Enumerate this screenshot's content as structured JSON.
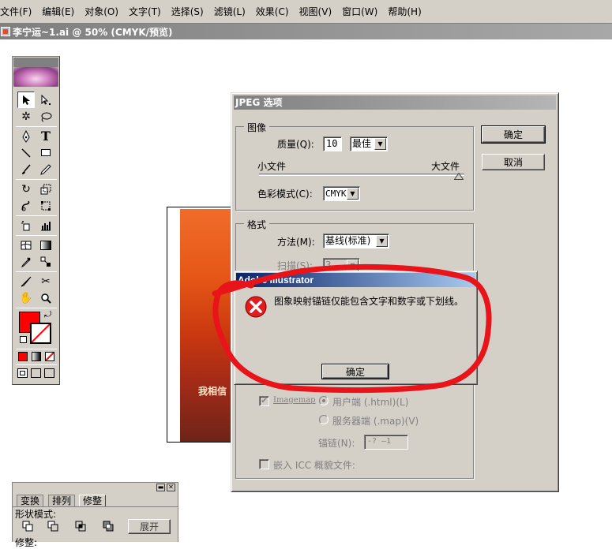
{
  "menu": [
    "文件(F)",
    "编辑(E)",
    "对象(O)",
    "文字(T)",
    "选择(S)",
    "滤镜(L)",
    "效果(C)",
    "视图(V)",
    "窗口(W)",
    "帮助(H)"
  ],
  "document": {
    "title": "李宁运~1.ai @ 50% (CMYK/预览)"
  },
  "artwork": {
    "text": "我相信"
  },
  "jpeg_dialog": {
    "title": "JPEG 选项",
    "image_group": "图像",
    "quality_label": "质量(Q):",
    "quality_value": "10",
    "quality_preset": "最佳",
    "small_file": "小文件",
    "large_file": "大文件",
    "color_mode_label": "色彩模式(C):",
    "color_mode_value": "CMYK",
    "format_group": "格式",
    "method_label": "方法(M):",
    "method_value": "基线(标准)",
    "scan_label": "扫描(S):",
    "scan_value": "3",
    "imagemap_label": "Imagemap",
    "client_side": "用户端 (.html)(L)",
    "server_side": "服务器端 (.map)(V)",
    "anchor_label": "锚链(N):",
    "anchor_value": "-?  —1",
    "embed_icc": "嵌入 ICC 概貌文件:",
    "ok_button": "确定",
    "cancel_button": "取消"
  },
  "alert": {
    "title": "Adobe Illustrator",
    "message": "图象映射锚链仅能包含文字和数字或下划线。",
    "ok_button": "确定"
  },
  "transform_panel": {
    "tabs": [
      "变换",
      "排列",
      "修整"
    ],
    "active_tab": "修整",
    "shape_modes_label": "形状模式:",
    "expand_button": "展开",
    "pathfinder_label": "修整:"
  },
  "colors": {
    "annotation": "#e8141a",
    "fill": "#ff0000",
    "alert_title": "#0a246a"
  }
}
